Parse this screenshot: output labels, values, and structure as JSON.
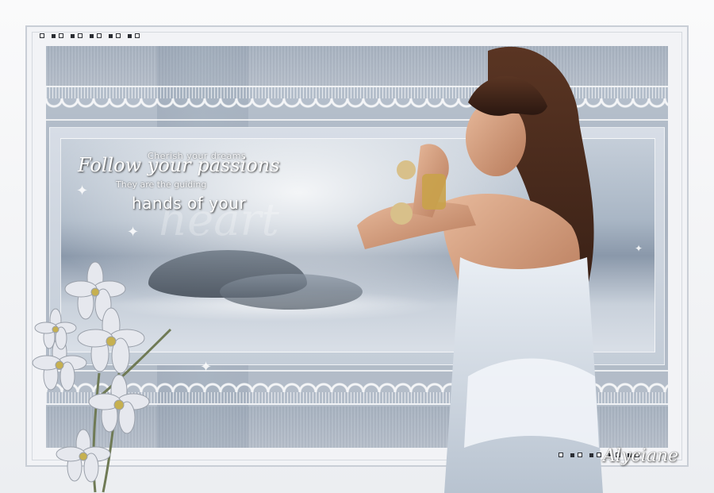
{
  "artwork": {
    "text_lines": {
      "line1": "Cherish your dreams",
      "line2": "Follow your passions",
      "line3": "They are the guiding",
      "line4": "hands of your",
      "line5": "heart"
    },
    "signature": "Alyciane"
  },
  "colors": {
    "frame": "#f4f5f7",
    "panel": "#b9c3cf",
    "accent_dark": "#2a2d33"
  },
  "icons": [
    "sparkle-icon",
    "flower-icon"
  ]
}
